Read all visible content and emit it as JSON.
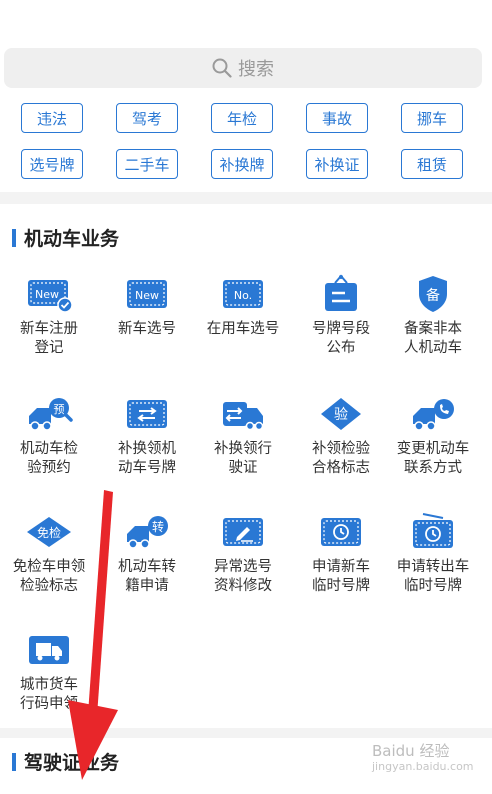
{
  "search": {
    "placeholder": "搜索"
  },
  "quick_links": [
    "违法",
    "驾考",
    "年检",
    "事故",
    "挪车",
    "选号牌",
    "二手车",
    "补换牌",
    "补换证",
    "租赁"
  ],
  "sections": {
    "motor": {
      "title": "机动车业务"
    },
    "license": {
      "title": "驾驶证业务"
    }
  },
  "services": [
    {
      "line1": "新车注册",
      "line2": "登记",
      "icon": "new-plate-check-icon",
      "tag": "New"
    },
    {
      "line1": "新车选号",
      "line2": "",
      "icon": "new-plate-icon",
      "tag": "New"
    },
    {
      "line1": "在用车选号",
      "line2": "",
      "icon": "number-plate-icon",
      "tag": "No."
    },
    {
      "line1": "号牌号段",
      "line2": "公布",
      "icon": "notice-board-icon",
      "tag": ""
    },
    {
      "line1": "备案非本",
      "line2": "人机动车",
      "icon": "shield-icon",
      "tag": "备"
    },
    {
      "line1": "机动车检",
      "line2": "验预约",
      "icon": "truck-search-icon",
      "tag": "预"
    },
    {
      "line1": "补换领机",
      "line2": "动车号牌",
      "icon": "plate-swap-icon",
      "tag": ""
    },
    {
      "line1": "补换领行",
      "line2": "驶证",
      "icon": "license-swap-icon",
      "tag": ""
    },
    {
      "line1": "补领检验",
      "line2": "合格标志",
      "icon": "inspection-badge-icon",
      "tag": "验"
    },
    {
      "line1": "变更机动车",
      "line2": "联系方式",
      "icon": "truck-phone-icon",
      "tag": ""
    },
    {
      "line1": "免检车申领",
      "line2": "检验标志",
      "icon": "exempt-badge-icon",
      "tag": "免检"
    },
    {
      "line1": "机动车转",
      "line2": "籍申请",
      "icon": "truck-transfer-icon",
      "tag": "转"
    },
    {
      "line1": "异常选号",
      "line2": "资料修改",
      "icon": "edit-card-icon",
      "tag": ""
    },
    {
      "line1": "申请新车",
      "line2": "临时号牌",
      "icon": "temp-plate-clock-icon",
      "tag": ""
    },
    {
      "line1": "申请转出车",
      "line2": "临时号牌",
      "icon": "temp-plate-radio-icon",
      "tag": ""
    },
    {
      "line1": "城市货车",
      "line2": "行码申领",
      "icon": "city-truck-icon",
      "tag": ""
    }
  ],
  "watermark": {
    "brand": "Baidu 经验",
    "url": "jingyan.baidu.com"
  },
  "colors": {
    "accent": "#2a78d4",
    "arrow": "#e8262a"
  }
}
